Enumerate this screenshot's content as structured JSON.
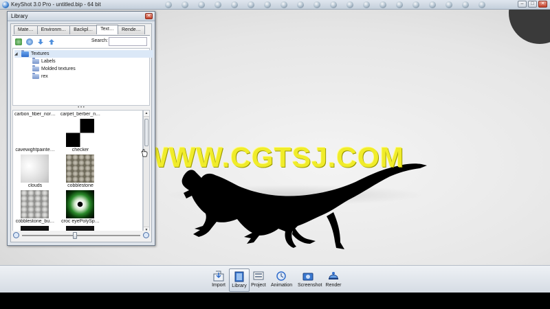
{
  "window": {
    "title": "KeyShot 3.0 Pro  - untitled.bip  - 64 bit",
    "minimize_glyph": "–",
    "maximize_glyph": "□",
    "close_glyph": "✕"
  },
  "viewport": {
    "watermark": "WWW.CGTSJ.COM"
  },
  "library": {
    "title": "Library",
    "close_glyph": "✕",
    "tabs": [
      {
        "label": "Mate…"
      },
      {
        "label": "Environm…"
      },
      {
        "label": "Backpl…"
      },
      {
        "label": "Text…",
        "active": true
      },
      {
        "label": "Rende…"
      }
    ],
    "search": {
      "label": "Search:",
      "value": ""
    },
    "tree": {
      "root": "Textures",
      "children": [
        "Labels",
        "Molded textures",
        "rex"
      ]
    },
    "thumbnails": [
      {
        "label": "carbon_fiber_nor…"
      },
      {
        "label": "carpet_berber_n…"
      },
      {
        "label": "cavewightpainte…"
      },
      {
        "label": "checker"
      },
      {
        "label": "clouds"
      },
      {
        "label": "cobblestone"
      },
      {
        "label": "cobblestone_bu…"
      },
      {
        "label": "croc eyePolySp…"
      }
    ],
    "zoom_value": 0.45
  },
  "bottom_toolbar": {
    "buttons": [
      {
        "label": "Import",
        "icon": "import-icon"
      },
      {
        "label": "Library",
        "icon": "library-icon",
        "active": true
      },
      {
        "label": "Project",
        "icon": "project-icon"
      },
      {
        "label": "Animation",
        "icon": "animation-icon"
      },
      {
        "label": "Screenshot",
        "icon": "screenshot-icon"
      },
      {
        "label": "Render",
        "icon": "render-icon"
      }
    ]
  },
  "colors": {
    "watermark": "#f0ec2a",
    "tree_selection": "#dbe8f7",
    "close_button": "#c4422c"
  }
}
